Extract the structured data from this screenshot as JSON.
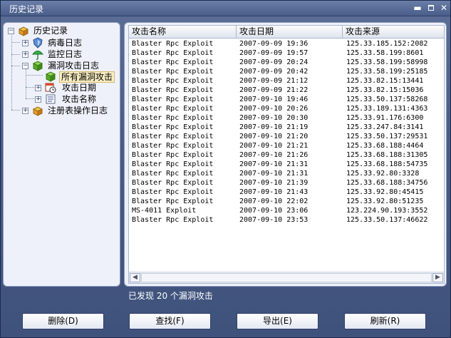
{
  "window": {
    "title": "历史记录"
  },
  "tree": {
    "root": "历史记录",
    "items": [
      {
        "label": "病毒日志"
      },
      {
        "label": "监控日志"
      },
      {
        "label": "漏洞攻击日志"
      },
      {
        "label": "所有漏洞攻击"
      },
      {
        "label": "攻击日期"
      },
      {
        "label": "攻击名称"
      },
      {
        "label": "注册表操作日志"
      }
    ]
  },
  "table": {
    "columns": [
      "攻击名称",
      "攻击日期",
      "攻击来源"
    ],
    "rows": [
      [
        "Blaster Rpc Exploit",
        "2007-09-09 19:36",
        "125.33.185.152:2082"
      ],
      [
        "Blaster Rpc Exploit",
        "2007-09-09 19:57",
        "125.33.58.199:8601"
      ],
      [
        "Blaster Rpc Exploit",
        "2007-09-09 20:24",
        "125.33.58.199:58998"
      ],
      [
        "Blaster Rpc Exploit",
        "2007-09-09 20:42",
        "125.33.58.199:25185"
      ],
      [
        "Blaster Rpc Exploit",
        "2007-09-09 21:12",
        "125.33.82.15:13441"
      ],
      [
        "Blaster Rpc Exploit",
        "2007-09-09 21:22",
        "125.33.82.15:15036"
      ],
      [
        "Blaster Rpc Exploit",
        "2007-09-10 19:46",
        "125.33.50.137:58268"
      ],
      [
        "Blaster Rpc Exploit",
        "2007-09-10 20:26",
        "125.33.189.131:4363"
      ],
      [
        "Blaster Rpc Exploit",
        "2007-09-10 20:30",
        "125.33.91.176:6300"
      ],
      [
        "Blaster Rpc Exploit",
        "2007-09-10 21:19",
        "125.33.247.84:3141"
      ],
      [
        "Blaster Rpc Exploit",
        "2007-09-10 21:20",
        "125.33.50.137:29531"
      ],
      [
        "Blaster Rpc Exploit",
        "2007-09-10 21:21",
        "125.33.68.188:4464"
      ],
      [
        "Blaster Rpc Exploit",
        "2007-09-10 21:26",
        "125.33.68.188:31305"
      ],
      [
        "Blaster Rpc Exploit",
        "2007-09-10 21:31",
        "125.33.68.188:54735"
      ],
      [
        "Blaster Rpc Exploit",
        "2007-09-10 21:31",
        "125.33.92.80:3328"
      ],
      [
        "Blaster Rpc Exploit",
        "2007-09-10 21:39",
        "125.33.68.188:34756"
      ],
      [
        "Blaster Rpc Exploit",
        "2007-09-10 21:43",
        "125.33.92.80:45415"
      ],
      [
        "Blaster Rpc Exploit",
        "2007-09-10 22:02",
        "125.33.92.80:51235"
      ],
      [
        "MS-4011 Exploit",
        "2007-09-10 23:06",
        "123.224.90.193:3552"
      ],
      [
        "Blaster Rpc Exploit",
        "2007-09-10 23:53",
        "125.33.50.137:46622"
      ]
    ]
  },
  "status": "已发现 20 个漏洞攻击",
  "buttons": {
    "delete": "删除(D)",
    "find": "查找(F)",
    "export": "导出(E)",
    "refresh": "刷新(R)"
  }
}
